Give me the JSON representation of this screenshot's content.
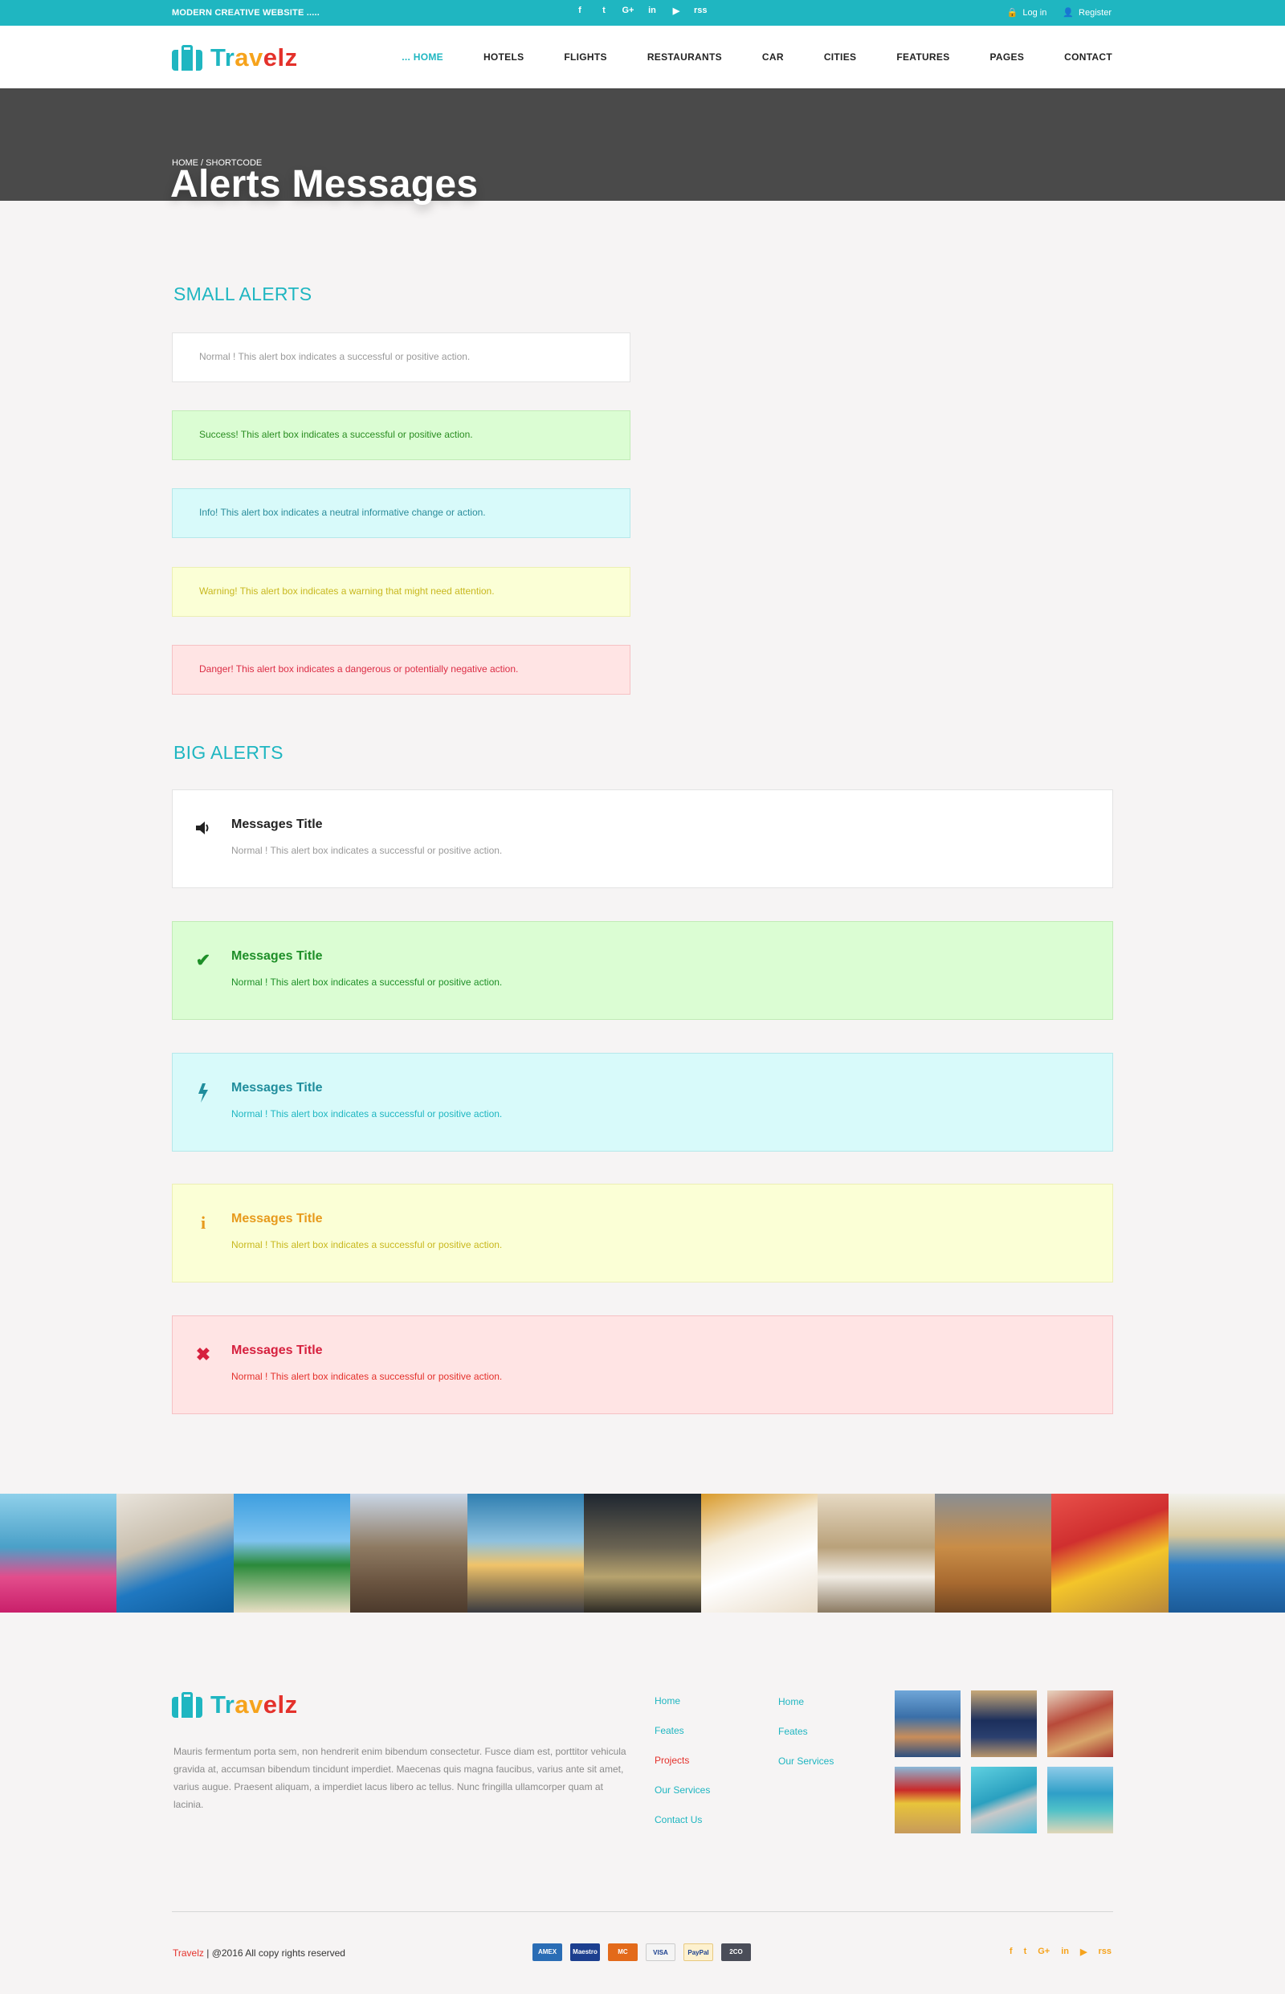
{
  "topbar": {
    "tagline": "MODERN CREATIVE  WEBSITE .....",
    "social": [
      "f",
      "t",
      "G+",
      "in",
      "▶",
      "rss"
    ],
    "login": "Log in",
    "register": "Register"
  },
  "brand": {
    "part1": "Tr",
    "part2": "av",
    "part3": "elz"
  },
  "nav": [
    {
      "label": "... HOME",
      "active": true
    },
    {
      "label": "HOTELS"
    },
    {
      "label": "FLIGHTS"
    },
    {
      "label": "RESTAURANTS"
    },
    {
      "label": "CAR"
    },
    {
      "label": "CITIES"
    },
    {
      "label": "FEATURES"
    },
    {
      "label": "PAGES"
    },
    {
      "label": "CONTACT"
    }
  ],
  "hero": {
    "breadcrumb": "HOME / SHORTCODE",
    "title": "Alerts Messages"
  },
  "small_alerts": {
    "heading": "SMALL ALERTS",
    "items": [
      "Normal ! This alert box indicates a successful or positive action.",
      "Success! This alert box indicates a successful or positive action.",
      "Info! This alert box indicates a neutral informative change or action.",
      "Warning! This alert box indicates a warning that might need attention.",
      "Danger! This alert box indicates a dangerous or potentially negative action."
    ]
  },
  "big_alerts": {
    "heading": "BIG ALERTS",
    "items": [
      {
        "icon": "speaker-icon",
        "title": "Messages Title",
        "message": "Normal ! This alert box indicates a successful or positive action."
      },
      {
        "icon": "check-icon",
        "title": "Messages Title",
        "message": "Normal ! This alert box indicates a successful or positive action."
      },
      {
        "icon": "bolt-icon",
        "title": "Messages Title",
        "message": "Normal ! This alert box indicates a successful or positive action."
      },
      {
        "icon": "info-icon",
        "title": "Messages Title",
        "message": "Normal ! This alert box indicates a successful or positive action."
      },
      {
        "icon": "close-icon",
        "title": "Messages Title",
        "message": "Normal ! This alert box indicates a successful or positive action."
      }
    ]
  },
  "footer": {
    "about": "Mauris fermentum porta sem, non hendrerit enim bibendum consectetur. Fusce diam est, porttitor vehicula gravida at, accumsan bibendum tincidunt imperdiet. Maecenas quis magna faucibus, varius ante sit amet, varius augue. Praesent aliquam, a imperdiet lacus libero ac tellus. Nunc fringilla ullamcorper quam at lacinia.",
    "links_col1": [
      "Home",
      "Feates",
      "Projects",
      "Our Services",
      "Contact Us"
    ],
    "links_col2": [
      "Home",
      "Feates",
      "Our Services"
    ],
    "copyright_brand": "Travelz",
    "copyright_text": "|   @2016 All copy rights reserved",
    "payments": [
      "AMEX",
      "Maestro",
      "MC",
      "VISA",
      "PayPal",
      "2CO"
    ],
    "social": [
      "f",
      "t",
      "G+",
      "in",
      "▶",
      "rss"
    ]
  },
  "colors": {
    "accent": "#1fb6c1",
    "orange": "#f6a31c",
    "red": "#e4312b"
  }
}
